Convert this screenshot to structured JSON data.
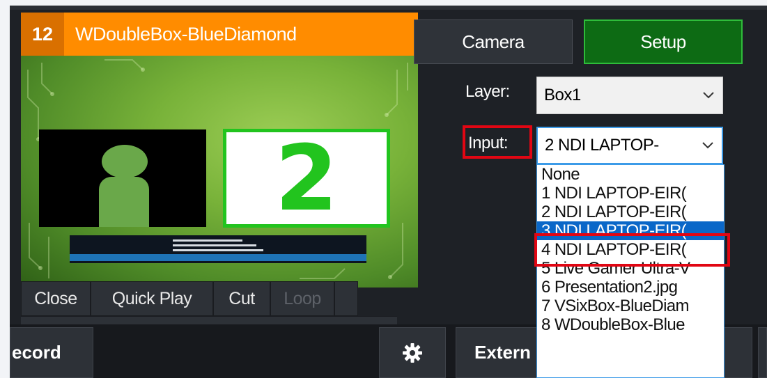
{
  "input_panel": {
    "number": "12",
    "title": "WDoubleBox-BlueDiamond",
    "preview": {
      "number_box": "2"
    }
  },
  "controls": [
    {
      "label": "Close",
      "enabled": true
    },
    {
      "label": "Quick Play",
      "enabled": true
    },
    {
      "label": "Cut",
      "enabled": true
    },
    {
      "label": "Loop",
      "enabled": false
    }
  ],
  "tabs": {
    "camera": "Camera",
    "setup": "Setup"
  },
  "layer": {
    "label": "Layer:",
    "value": "Box1"
  },
  "input": {
    "label": "Input:",
    "value": "2 NDI LAPTOP-"
  },
  "dropdown": {
    "items": [
      "None",
      "1 NDI LAPTOP-EIR(",
      "2 NDI LAPTOP-EIR(",
      "3 NDI LAPTOP-EIR(",
      "4 NDI LAPTOP-EIR(",
      "5 Live Gamer Ultra-V",
      "6 Presentation2.jpg",
      "7 VSixBox-BlueDiam",
      "8 WDoubleBox-Blue"
    ],
    "selected_index": 3
  },
  "bottom_bar": {
    "record": "ecord",
    "external": "Extern",
    "gear_icon": "gear-icon"
  },
  "colors": {
    "header_orange": "#ff8c00",
    "setup_green": "#0d6b14",
    "highlight_red": "#e10613",
    "selection_blue": "#0a67c8"
  }
}
